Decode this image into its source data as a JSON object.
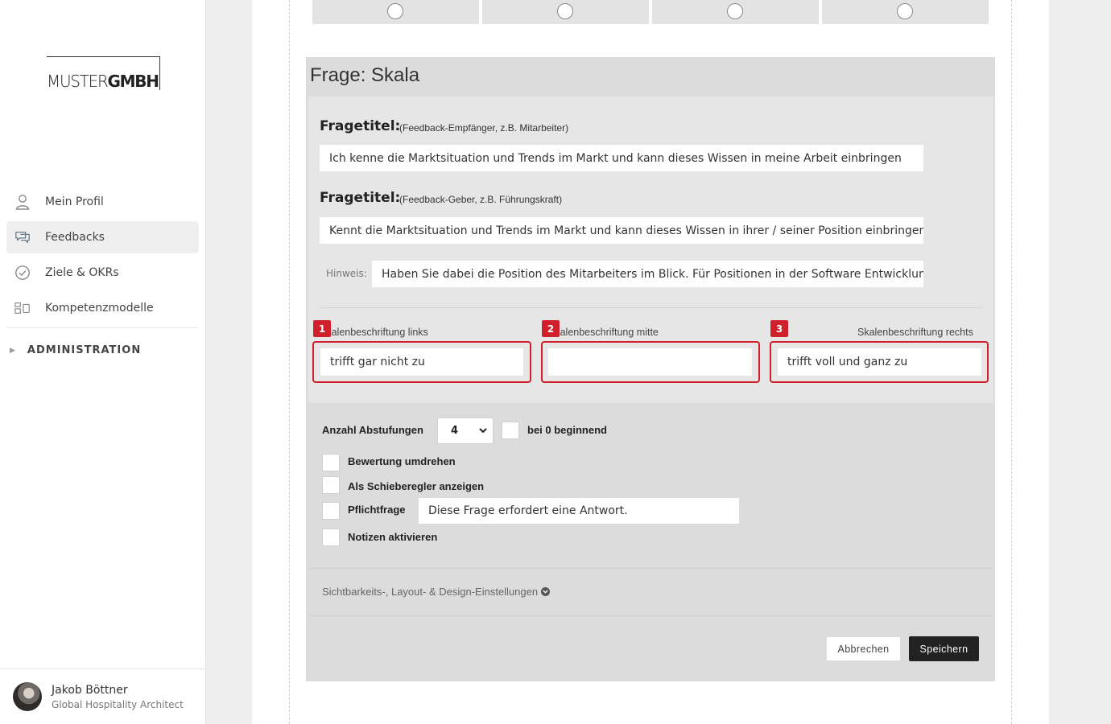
{
  "brand": {
    "logo_light": "MUSTER",
    "logo_bold": "GMBH"
  },
  "sidebar": {
    "items": [
      {
        "label": "Mein Profil",
        "icon": "user-icon",
        "active": false
      },
      {
        "label": "Feedbacks",
        "icon": "chat-icon",
        "active": true
      },
      {
        "label": "Ziele & OKRs",
        "icon": "check-circle-icon",
        "active": false
      },
      {
        "label": "Kompetenzmodelle",
        "icon": "model-icon",
        "active": false
      }
    ],
    "admin_label": "ADMINISTRATION"
  },
  "user": {
    "name": "Jakob Böttner",
    "role": "Global Hospitality Architect"
  },
  "panel": {
    "title": "Frage: Skala",
    "question_title_label": "Fragetitel:",
    "recipient_hint": "(Feedback-Empfänger, z.B. Mitarbeiter)",
    "recipient_value": "Ich kenne die Marktsituation und Trends im Markt und kann dieses Wissen in meine Arbeit einbringen",
    "giver_hint": "(Feedback-Geber, z.B. Führungskraft)",
    "giver_value": "Kennt die Marktsituation und Trends im Markt und kann dieses Wissen in ihrer / seiner Position einbringen",
    "hint_label": "Hinweis:",
    "hint_value": "Haben Sie dabei die Position des Mitarbeiters im Blick. Für Positionen in der Software Entwicklung",
    "scale_left_label": "Skalenbeschriftung links",
    "scale_left_value": "trifft gar nicht zu",
    "scale_mid_label": "Skalenbeschriftung mitte",
    "scale_mid_value": "",
    "scale_right_label": "Skalenbeschriftung rechts",
    "scale_right_value": "trifft voll und ganz zu",
    "badges": [
      "1",
      "2",
      "3"
    ],
    "highlight_color": "#d0202b"
  },
  "options": {
    "steps_label": "Anzahl Abstufungen",
    "steps_value": "4",
    "zero_start_label": "bei 0 beginnend",
    "reverse_label": "Bewertung umdrehen",
    "slider_label": "Als Schieberegler anzeigen",
    "required_label": "Pflichtfrage",
    "required_message": "Diese Frage erfordert eine Antwort.",
    "notes_label": "Notizen aktivieren"
  },
  "visibility_link": "Sichtbarkeits-, Layout- & Design-Einstellungen",
  "buttons": {
    "cancel": "Abbrechen",
    "save": "Speichern"
  }
}
